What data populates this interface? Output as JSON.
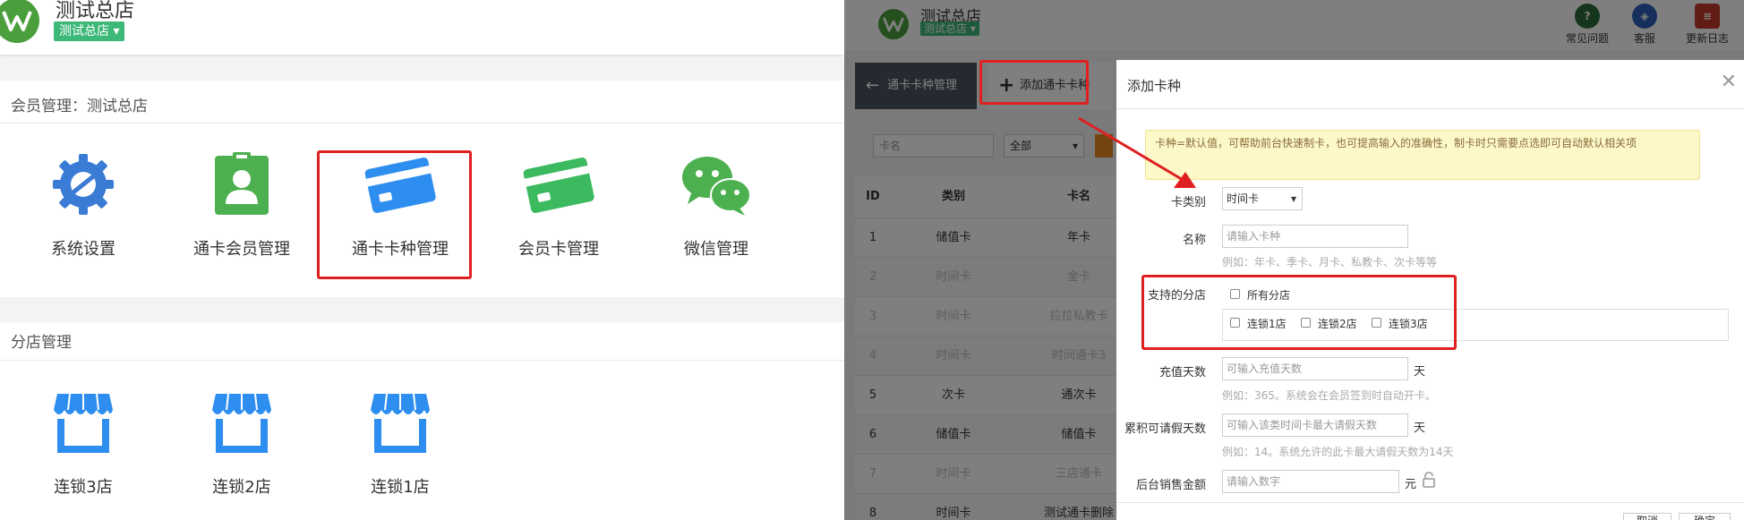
{
  "left": {
    "header": {
      "title": "测试总店",
      "store_badge": "测试总店"
    },
    "member_section": {
      "title": "会员管理：测试总店",
      "tiles": [
        {
          "label": "系统设置",
          "icon": "gear-icon"
        },
        {
          "label": "通卡会员管理",
          "icon": "member-id-icon"
        },
        {
          "label": "通卡卡种管理",
          "icon": "card-icon"
        },
        {
          "label": "会员卡管理",
          "icon": "card-icon"
        },
        {
          "label": "微信管理",
          "icon": "wechat-icon"
        }
      ]
    },
    "branch_section": {
      "title": "分店管理",
      "tiles": [
        {
          "label": "连锁3店",
          "icon": "store-icon"
        },
        {
          "label": "连锁2店",
          "icon": "store-icon"
        },
        {
          "label": "连锁1店",
          "icon": "store-icon"
        }
      ]
    }
  },
  "right": {
    "header": {
      "title": "测试总店",
      "store_badge": "测试总店",
      "icons": [
        {
          "label": "常见问题",
          "icon": "help-icon",
          "color": "#2d6b3a"
        },
        {
          "label": "客服",
          "icon": "service-icon",
          "color": "#2e5eb8"
        },
        {
          "label": "更新日志",
          "icon": "log-icon",
          "color": "#c0392b"
        }
      ]
    },
    "toolbar": {
      "back_label": "通卡卡种管理",
      "add_label": "添加通卡卡种"
    },
    "filters": {
      "name_placeholder": "卡名",
      "type_value": "全部"
    },
    "table": {
      "headers": [
        "ID",
        "类别",
        "卡名"
      ],
      "rows": [
        [
          "1",
          "储值卡",
          "年卡"
        ],
        [
          "2",
          "时间卡",
          "金卡"
        ],
        [
          "3",
          "时间卡",
          "拉拉私教卡"
        ],
        [
          "4",
          "时间卡",
          "时间通卡3"
        ],
        [
          "5",
          "次卡",
          "通次卡"
        ],
        [
          "6",
          "储值卡",
          "储值卡"
        ],
        [
          "7",
          "时间卡",
          "三店通卡"
        ],
        [
          "8",
          "时间卡",
          "测试通卡删除"
        ]
      ]
    },
    "modal": {
      "title": "添加卡种",
      "tip": "卡种=默认值，可帮助前台快速制卡，也可提高输入的准确性，制卡时只需要点选即可自动默认相关项",
      "card_type_label": "卡类别",
      "card_type_value": "时间卡",
      "name_label": "名称",
      "name_placeholder": "请输入卡种",
      "name_hint": "例如：年卡、季卡、月卡、私教卡、次卡等等",
      "stores_label": "支持的分店",
      "all_stores_label": "所有分店",
      "stores": [
        "连锁1店",
        "连锁2店",
        "连锁3店"
      ],
      "days_label": "充值天数",
      "days_placeholder": "可输入充值天数",
      "days_unit": "天",
      "days_hint": "例如：365。系统会在会员签到时自动开卡。",
      "leave_label": "累积可请假天数",
      "leave_placeholder": "可输入该类时间卡最大请假天数",
      "leave_unit": "天",
      "leave_hint": "例如：14。系统允许的此卡最大请假天数为14天",
      "price_label": "后台销售金额",
      "price_placeholder": "请输入数字",
      "price_unit": "元",
      "cancel_label": "取消",
      "confirm_label": "确定"
    }
  }
}
